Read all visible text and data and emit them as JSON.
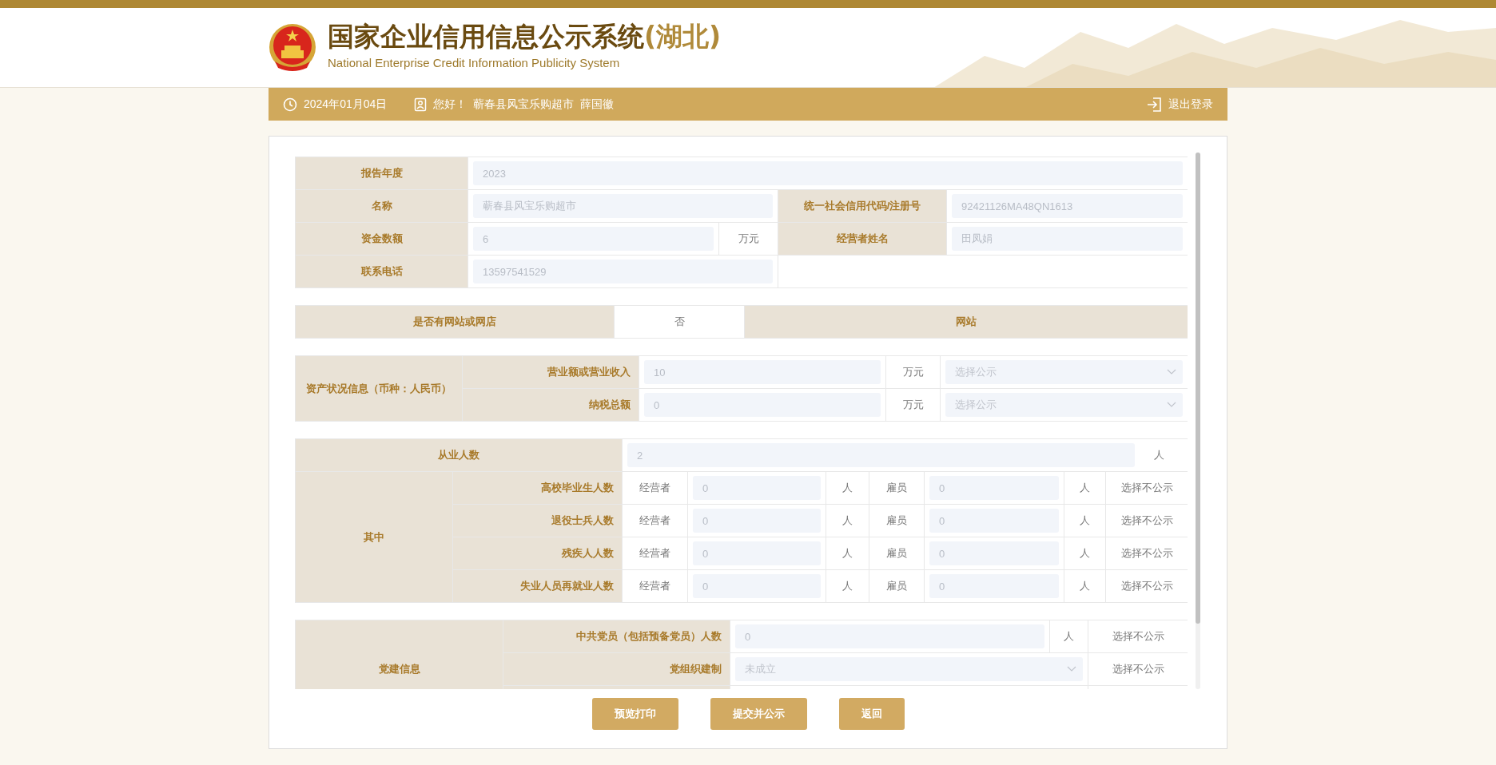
{
  "header": {
    "title": "国家企业信用信息公示系统",
    "region": "(湖北)",
    "subtitle": "National Enterprise Credit Information Publicity System"
  },
  "user_bar": {
    "date": "2024年01月04日",
    "greeting": "您好！",
    "company": "蕲春县风宝乐购超市",
    "person": "薛国徽",
    "logout": "退出登录"
  },
  "basic_info": {
    "report_year": {
      "label": "报告年度",
      "value": "2023"
    },
    "name": {
      "label": "名称",
      "value": "蕲春县风宝乐购超市"
    },
    "credit_code": {
      "label": "统一社会信用代码/注册号",
      "value": "92421126MA48QN1613"
    },
    "capital": {
      "label": "资金数额",
      "value": "6",
      "unit": "万元"
    },
    "operator_name": {
      "label": "经营者姓名",
      "value": "田凤娟"
    },
    "phone": {
      "label": "联系电话",
      "value": "13597541529"
    }
  },
  "website": {
    "label": "是否有网站或网店",
    "value": "否",
    "type_label": "网站"
  },
  "assets": {
    "label": "资产状况信息（币种：人民币）",
    "rows": [
      {
        "label": "营业额或营业收入",
        "value": "10",
        "unit": "万元",
        "publicity_placeholder": "选择公示"
      },
      {
        "label": "纳税总额",
        "value": "0",
        "unit": "万元",
        "publicity_placeholder": "选择公示"
      }
    ]
  },
  "employees": {
    "label": "从业人数",
    "value": "2",
    "unit": "人",
    "breakdown_label": "其中",
    "rows": [
      {
        "label": "高校毕业生人数",
        "operator_label": "经营者",
        "operator_value": "0",
        "operator_unit": "人",
        "employee_label": "雇员",
        "employee_value": "0",
        "employee_unit": "人",
        "privacy": "选择不公示"
      },
      {
        "label": "退役士兵人数",
        "operator_label": "经营者",
        "operator_value": "0",
        "operator_unit": "人",
        "employee_label": "雇员",
        "employee_value": "0",
        "employee_unit": "人",
        "privacy": "选择不公示"
      },
      {
        "label": "残疾人人数",
        "operator_label": "经营者",
        "operator_value": "0",
        "operator_unit": "人",
        "employee_label": "雇员",
        "employee_value": "0",
        "employee_unit": "人",
        "privacy": "选择不公示"
      },
      {
        "label": "失业人员再就业人数",
        "operator_label": "经营者",
        "operator_value": "0",
        "operator_unit": "人",
        "employee_label": "雇员",
        "employee_value": "0",
        "employee_unit": "人",
        "privacy": "选择不公示"
      }
    ]
  },
  "party": {
    "label": "党建信息",
    "rows": [
      {
        "kind": "input",
        "label": "中共党员（包括预备党员）人数",
        "value": "0",
        "unit": "人",
        "privacy": "选择不公示"
      },
      {
        "kind": "select",
        "label": "党组织建制",
        "value": "未成立",
        "privacy": "选择不公示"
      }
    ]
  },
  "buttons": [
    "预览打印",
    "提交并公示",
    "返回"
  ]
}
